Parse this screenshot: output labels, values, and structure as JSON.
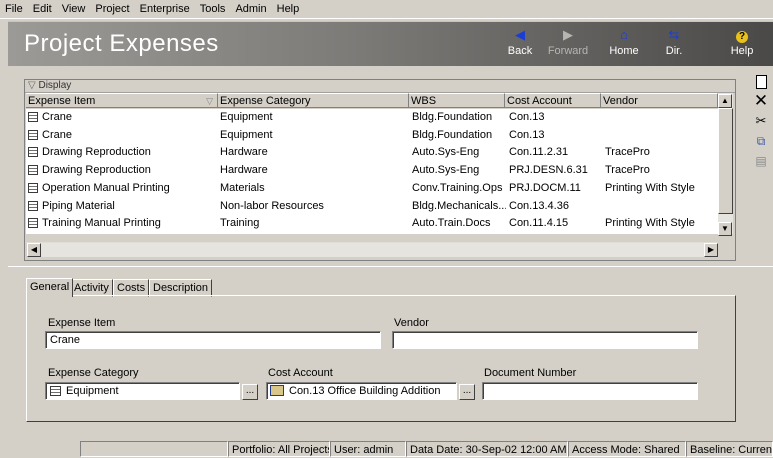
{
  "menu": [
    "File",
    "Edit",
    "View",
    "Project",
    "Enterprise",
    "Tools",
    "Admin",
    "Help"
  ],
  "header": {
    "title": "Project Expenses",
    "nav": [
      {
        "label": "Back",
        "icon": "back-arrow-icon",
        "glyph": "◀",
        "enabled": true
      },
      {
        "label": "Forward",
        "icon": "forward-arrow-icon",
        "glyph": "▶",
        "enabled": false
      },
      {
        "label": "Home",
        "icon": "home-icon",
        "glyph": "⌂",
        "enabled": true
      },
      {
        "label": "Dir.",
        "icon": "signpost-icon",
        "glyph": "⇆",
        "enabled": true
      },
      {
        "label": "Help",
        "icon": "help-icon",
        "glyph": "?",
        "enabled": true
      }
    ]
  },
  "grid": {
    "display_label": "Display",
    "columns": [
      "Expense Item",
      "Expense Category",
      "WBS",
      "Cost Account",
      "Vendor"
    ],
    "rows": [
      {
        "item": "Crane",
        "category": "Equipment",
        "wbs": "Bldg.Foundation",
        "account": "Con.13",
        "vendor": ""
      },
      {
        "item": "Crane",
        "category": "Equipment",
        "wbs": "Bldg.Foundation",
        "account": "Con.13",
        "vendor": ""
      },
      {
        "item": "Drawing Reproduction",
        "category": "Hardware",
        "wbs": "Auto.Sys-Eng",
        "account": "Con.11.2.31",
        "vendor": "TracePro"
      },
      {
        "item": "Drawing Reproduction",
        "category": "Hardware",
        "wbs": "Auto.Sys-Eng",
        "account": "PRJ.DESN.6.31",
        "vendor": "TracePro"
      },
      {
        "item": "Operation Manual Printing",
        "category": "Materials",
        "wbs": "Conv.Training.Ops",
        "account": "PRJ.DOCM.11",
        "vendor": "Printing With Style"
      },
      {
        "item": "Piping Material",
        "category": "Non-labor Resources",
        "wbs": "Bldg.Mechanicals...",
        "account": "Con.13.4.36",
        "vendor": ""
      },
      {
        "item": "Training Manual Printing",
        "category": "Training",
        "wbs": "Auto.Train.Docs",
        "account": "Con.11.4.15",
        "vendor": "Printing With Style"
      }
    ]
  },
  "side_tools": [
    {
      "name": "new-icon",
      "glyph": "🗋"
    },
    {
      "name": "delete-icon",
      "glyph": "✕"
    },
    {
      "name": "cut-icon",
      "glyph": "✂"
    },
    {
      "name": "copy-icon",
      "glyph": "⧉"
    },
    {
      "name": "paste-icon",
      "glyph": "▤"
    }
  ],
  "details": {
    "tabs": [
      "General",
      "Activity",
      "Costs",
      "Description"
    ],
    "active_tab": "General",
    "fields": {
      "expense_item_label": "Expense Item",
      "expense_item_value": "Crane",
      "vendor_label": "Vendor",
      "vendor_value": "",
      "expense_category_label": "Expense Category",
      "expense_category_value": "Equipment",
      "cost_account_label": "Cost Account",
      "cost_account_value": "Con.13  Office Building Addition",
      "document_number_label": "Document Number",
      "document_number_value": "",
      "ellipsis": "..."
    }
  },
  "status": {
    "portfolio": "Portfolio: All Projects",
    "user": "User: admin",
    "data_date": "Data Date: 30-Sep-02 12:00 AM",
    "access_mode": "Access Mode: Shared",
    "baseline": "Baseline: Current"
  }
}
